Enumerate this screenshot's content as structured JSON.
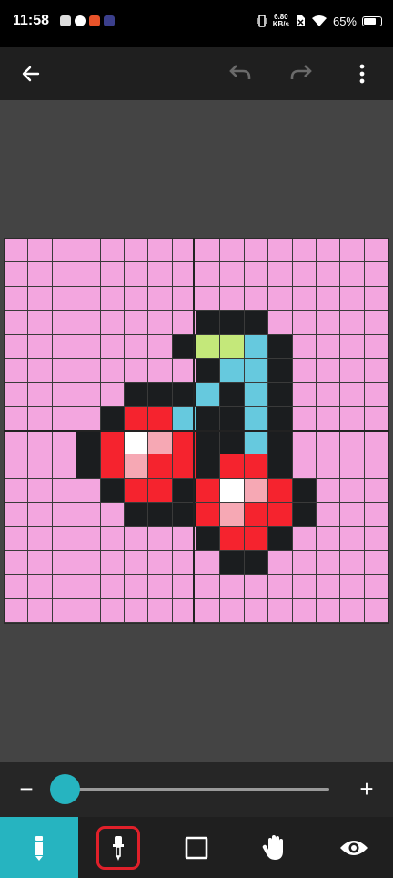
{
  "status_bar": {
    "time": "11:58",
    "net_speed_value": "6.80",
    "net_speed_unit": "KB/s",
    "battery": "65%"
  },
  "toolbar": {
    "back_icon": "arrow-back-icon",
    "undo_icon": "undo-icon",
    "redo_icon": "redo-icon",
    "menu_icon": "more-vert-icon"
  },
  "canvas": {
    "size": 16,
    "palette": {
      "P": "#f3a6df",
      "K": "#1b1d1f",
      "G": "#c4e87a",
      "C": "#66c9de",
      "R": "#f5232e",
      "W": "#ffffff",
      "L": "#f6a8b4"
    },
    "rows": [
      "PPPPPPPPPPPPPPPP",
      "PPPPPPPPPPPPPPPP",
      "PPPPPPPPPPPPPPPP",
      "PPPPPPPPKKKPPPPP",
      "PPPPPPPKGGCKPPPP",
      "PPPPPPPPKCCKPPPP",
      "PPPPPKKKCKCKPPPP",
      "PPPPKRRCKKCKPPPP",
      "PPPKRWLRKKCKPPPP",
      "PPPKRLRRKRRKPPPP",
      "PPPPKRRKRWLRKPPP",
      "PPPPPKKKRLRRKPPP",
      "PPPPPPPPKRRKPPPP",
      "PPPPPPPPPKKPPPPP",
      "PPPPPPPPPPPPPPPP",
      "PPPPPPPPPPPPPPPP"
    ]
  },
  "zoom": {
    "minus_label": "−",
    "plus_label": "+",
    "level": 0.03
  },
  "tools": [
    {
      "name": "pencil-tool",
      "icon": "pencil-icon",
      "active": true
    },
    {
      "name": "eyedropper-tool",
      "icon": "eyedropper-icon",
      "active": false
    },
    {
      "name": "rectangle-tool",
      "icon": "square-icon",
      "active": false
    },
    {
      "name": "hand-tool",
      "icon": "hand-icon",
      "active": false
    },
    {
      "name": "preview-tool",
      "icon": "eye-icon",
      "active": false
    }
  ],
  "colors": {
    "accent": "#26b4c0",
    "highlight": "#e0202a"
  }
}
